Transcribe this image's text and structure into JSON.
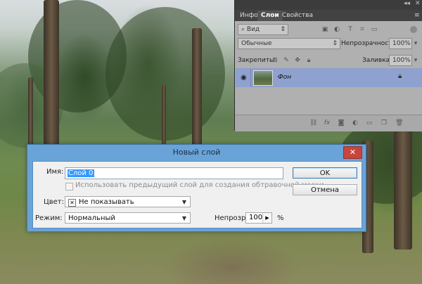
{
  "panel": {
    "tabs": [
      "Инфо",
      "Слои",
      "Свойства"
    ],
    "active_tab": "Слои",
    "kind_filter": "Вид",
    "blend_mode": "Обычные",
    "opacity_label": "Непрозрачность:",
    "opacity_value": "100%",
    "lock_label": "Закрепить:",
    "fill_label": "Заливка:",
    "fill_value": "100%",
    "layer_name": "Фон",
    "collapse_glyph": "◂◂",
    "close_glyph": "✕",
    "menu_glyph": "≡"
  },
  "dialog": {
    "title": "Новый слой",
    "close_glyph": "✕",
    "name_label": "Имя:",
    "name_value": "Слой 0",
    "clip_checkbox_label": "Использовать предыдущий слой для создания обтравочной маски",
    "color_label": "Цвет:",
    "color_value": "Не показывать",
    "mode_label": "Режим:",
    "mode_value": "Нормальный",
    "opacity_label": "Непрозр.:",
    "opacity_value": "100",
    "opacity_unit": "%",
    "ok_label": "OK",
    "cancel_label": "Отмена"
  },
  "colors": {
    "dialog_frame": "#6aa3d8",
    "layer_selected": "#8ea1cf",
    "close_red": "#c8453c",
    "selection_blue": "#3399ff"
  }
}
